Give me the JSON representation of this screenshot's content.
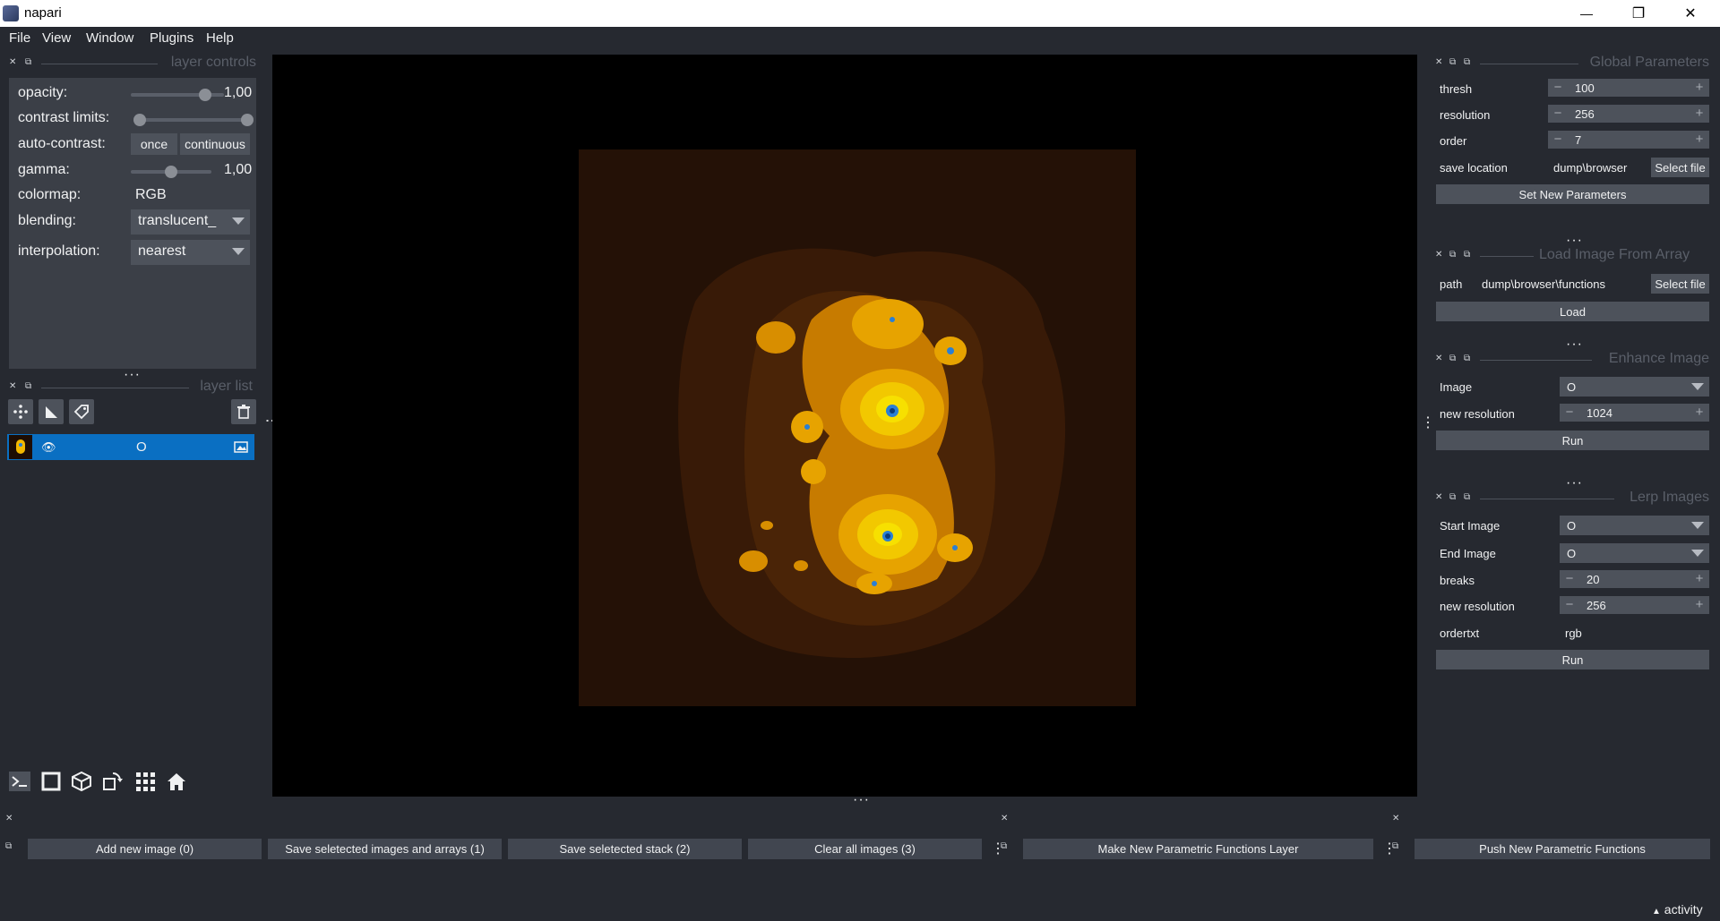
{
  "window": {
    "title": "napari",
    "minimize_glyph": "—",
    "maximize_glyph": "❐",
    "close_glyph": "✕"
  },
  "menu": [
    "File",
    "View",
    "Window",
    "Plugins",
    "Help"
  ],
  "layer_controls": {
    "title": "layer controls",
    "opacity_label": "opacity:",
    "opacity_value": "1,00",
    "opacity_level": 1.0,
    "contrast_label": "contrast limits:",
    "autocontrast_label": "auto-contrast:",
    "once": "once",
    "continuous": "continuous",
    "gamma_label": "gamma:",
    "gamma_value": "1,00",
    "gamma_level": 0.5,
    "colormap_label": "colormap:",
    "colormap_value": "RGB",
    "blending_label": "blending:",
    "blending_value": "translucent_",
    "interpolation_label": "interpolation:",
    "interpolation_value": "nearest"
  },
  "layer_list": {
    "title": "layer list",
    "layers": [
      {
        "name": "O",
        "visible": true
      }
    ]
  },
  "global_params": {
    "title": "Global Parameters",
    "thresh_label": "thresh",
    "thresh_value": "100",
    "resolution_label": "resolution",
    "resolution_value": "256",
    "order_label": "order",
    "order_value": "7",
    "save_label": "save location",
    "save_value": "dump\\browser",
    "select_file": "Select file",
    "set_button": "Set New Parameters"
  },
  "load_image": {
    "title": "Load Image From Array",
    "path_label": "path",
    "path_value": "dump\\browser\\functions",
    "select_file": "Select file",
    "load_button": "Load"
  },
  "enhance": {
    "title": "Enhance Image",
    "image_label": "Image",
    "image_value": "O",
    "res_label": "new resolution",
    "res_value": "1024",
    "run": "Run"
  },
  "lerp": {
    "title": "Lerp Images",
    "start_label": "Start Image",
    "start_value": "O",
    "end_label": "End Image",
    "end_value": "O",
    "breaks_label": "breaks",
    "breaks_value": "20",
    "res_label": "new resolution",
    "res_value": "256",
    "ordertxt_label": "ordertxt",
    "ordertxt_value": "rgb",
    "run": "Run"
  },
  "bottom": {
    "add": "Add new image (0)",
    "save_images": "Save seletected images and arrays (1)",
    "save_stack": "Save seletected stack (2)",
    "clear": "Clear all images (3)",
    "make_layer": "Make New Parametric Functions Layer",
    "push": "Push New Parametric Functions"
  },
  "status": {
    "activity": "activity"
  },
  "colors": {
    "accent": "#0a6fc2",
    "panel": "#3b3f47",
    "background": "#262930"
  }
}
